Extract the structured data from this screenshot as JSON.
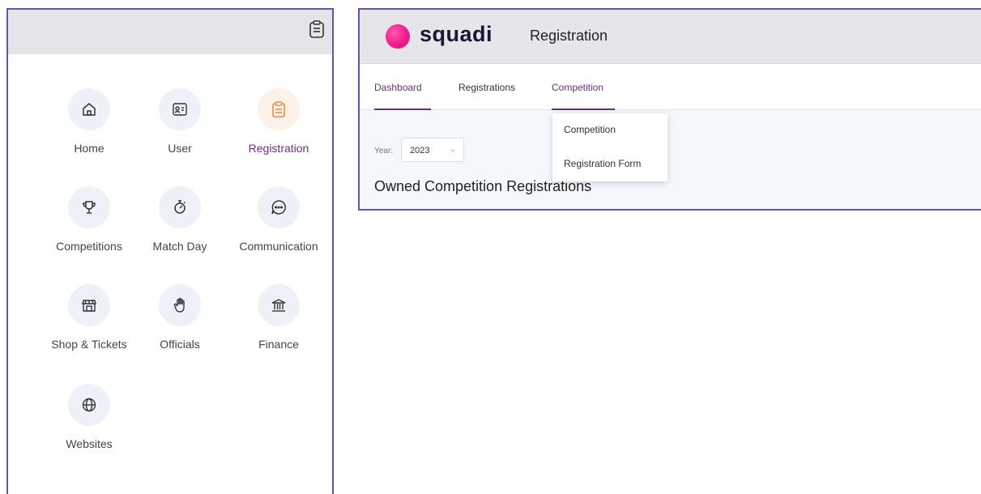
{
  "menu": {
    "header_icon": "clipboard-icon",
    "tiles": [
      {
        "label": "Home",
        "icon": "home-icon"
      },
      {
        "label": "User",
        "icon": "id-card-icon"
      },
      {
        "label": "Registration",
        "icon": "clipboard-icon",
        "active": true
      },
      {
        "label": "Competitions",
        "icon": "trophy-icon"
      },
      {
        "label": "Match Day",
        "icon": "stopwatch-icon"
      },
      {
        "label": "Communication",
        "icon": "chat-icon"
      },
      {
        "label": "Shop & Tickets",
        "icon": "shop-icon"
      },
      {
        "label": "Officials",
        "icon": "hand-icon"
      },
      {
        "label": "Finance",
        "icon": "bank-icon"
      },
      {
        "label": "Websites",
        "icon": "globe-icon"
      }
    ]
  },
  "app": {
    "logo": "squadi",
    "title": "Registration",
    "tabs": [
      {
        "label": "Dashboard"
      },
      {
        "label": "Registrations"
      },
      {
        "label": "Competition"
      }
    ],
    "year_label": "Year:",
    "year_value": "2023",
    "section_title": "Owned Competition Registrations",
    "dropdown": {
      "items": [
        "Competition",
        "Registration Form"
      ]
    }
  },
  "colors": {
    "accent": "#6a2f7d",
    "frame": "#6f4ea6",
    "logo_pink": "#ef1c8d",
    "active_tile_bg": "#fdf1ea",
    "active_icon": "#f08a4b"
  }
}
